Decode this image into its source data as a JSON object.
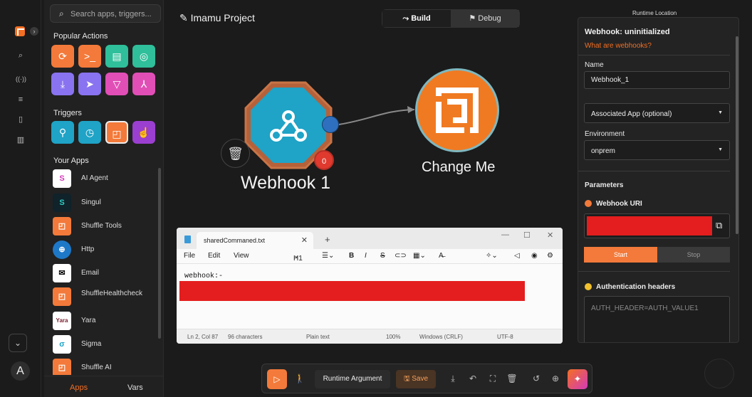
{
  "side": {
    "search_placeholder": "Search apps, triggers...",
    "popular_title": "Popular Actions",
    "triggers_title": "Triggers",
    "apps_title": "Your Apps",
    "apps": [
      {
        "label": "AI Agent"
      },
      {
        "label": "Singul"
      },
      {
        "label": "Shuffle Tools"
      },
      {
        "label": "Http"
      },
      {
        "label": "Email"
      },
      {
        "label": "ShuffleHealthcheck"
      },
      {
        "label": "Yara"
      },
      {
        "label": "Sigma"
      },
      {
        "label": "Shuffle AI"
      }
    ],
    "tab_apps": "Apps",
    "tab_vars": "Vars",
    "avatar_letter": "A"
  },
  "header": {
    "project_title": "Imamu Project",
    "build_label": "Build",
    "debug_label": "Debug"
  },
  "canvas": {
    "webhook_label": "Webhook 1",
    "badge_count": "0",
    "target_label": "Change Me"
  },
  "notepad": {
    "tab_title": "sharedCommaned.txt",
    "menu": {
      "file": "File",
      "edit": "Edit",
      "view": "View",
      "heading": "H1"
    },
    "content_line": "webhook:-",
    "status": {
      "position": "Ln 2, Col 87",
      "characters": "96 characters",
      "format": "Plain text",
      "zoom": "100%",
      "line_endings": "Windows (CRLF)",
      "encoding": "UTF-8"
    }
  },
  "panel": {
    "runtime_location": "Runtime Location",
    "title": "Webhook: uninitialized",
    "help_link": "What are webhooks?",
    "name_label": "Name",
    "name_value": "Webhook_1",
    "associated_app": "Associated App (optional)",
    "environment_label": "Environment",
    "environment_value": "onprem",
    "parameters_label": "Parameters",
    "webhook_uri_label": "Webhook URI",
    "start_label": "Start",
    "stop_label": "Stop",
    "auth_label": "Authentication headers",
    "auth_placeholder": "AUTH_HEADER=AUTH_VALUE1"
  },
  "toolbar": {
    "runtime_argument": "Runtime Argument",
    "save_label": "Save"
  },
  "colors": {
    "accent": "#f36f23",
    "webhook_node": "#1fa3c6",
    "port": "#2f6fbf",
    "redaction": "#e41e1e"
  }
}
